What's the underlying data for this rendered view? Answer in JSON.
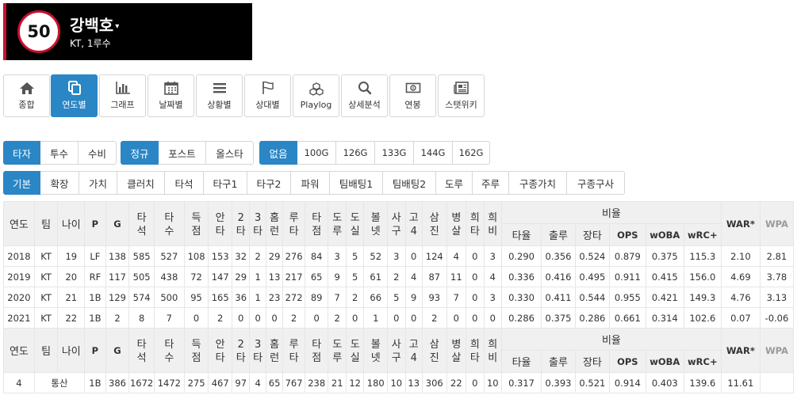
{
  "player": {
    "number": "50",
    "name": "강백호",
    "dropdown_caret": "▾",
    "team_position": "KT, 1루수",
    "accent": "#c8102e"
  },
  "nav": [
    {
      "label": "종합",
      "icon": "home-icon"
    },
    {
      "label": "연도별",
      "icon": "copy-icon",
      "active": true
    },
    {
      "label": "그래프",
      "icon": "bar-chart-icon"
    },
    {
      "label": "날짜별",
      "icon": "calendar-icon"
    },
    {
      "label": "상황별",
      "icon": "list-icon"
    },
    {
      "label": "상대별",
      "icon": "flag-icon"
    },
    {
      "label": "Playlog",
      "icon": "cubes-icon"
    },
    {
      "label": "상세분석",
      "icon": "search-icon"
    },
    {
      "label": "연봉",
      "icon": "money-icon"
    },
    {
      "label": "스탯위키",
      "icon": "newspaper-icon"
    }
  ],
  "filters": {
    "role": [
      "타자",
      "투수",
      "수비"
    ],
    "season_type": [
      "정규",
      "포스트",
      "올스타"
    ],
    "games": [
      "없음",
      "100G",
      "126G",
      "133G",
      "144G",
      "162G"
    ],
    "categories": [
      "기본",
      "확장",
      "가치",
      "클러치",
      "타석",
      "타구1",
      "타구2",
      "파워",
      "팀배팅1",
      "팀배팅2",
      "도루",
      "주루",
      "구종가치",
      "구종구사"
    ]
  },
  "table": {
    "headers": {
      "year": "연도",
      "team": "팀",
      "age": "나이",
      "pos": "P",
      "g": "G",
      "pa": "타석",
      "ab": "타수",
      "r": "득점",
      "h": "안타",
      "b2": "2타",
      "b3": "3타",
      "hr": "홈런",
      "tb": "루타",
      "rbi": "타점",
      "sb": "도루",
      "cs": "도실",
      "bb": "볼넷",
      "hbp": "사구",
      "ibb": "고4",
      "so": "삼진",
      "gdp": "병살",
      "sh": "희타",
      "sf": "희비",
      "ratio": "비율",
      "avg": "타율",
      "obp": "출루",
      "slg": "장타",
      "ops": "OPS",
      "woba": "wOBA",
      "wrc": "wRC+",
      "war": "WAR*",
      "wpa": "WPA"
    },
    "rows": [
      [
        "2018",
        "KT",
        "19",
        "LF",
        "138",
        "585",
        "527",
        "108",
        "153",
        "32",
        "2",
        "29",
        "276",
        "84",
        "3",
        "5",
        "52",
        "3",
        "0",
        "124",
        "4",
        "0",
        "3",
        "0.290",
        "0.356",
        "0.524",
        "0.879",
        "0.375",
        "115.3",
        "2.10",
        "2.81"
      ],
      [
        "2019",
        "KT",
        "20",
        "RF",
        "117",
        "505",
        "438",
        "72",
        "147",
        "29",
        "1",
        "13",
        "217",
        "65",
        "9",
        "5",
        "61",
        "2",
        "4",
        "87",
        "11",
        "0",
        "4",
        "0.336",
        "0.416",
        "0.495",
        "0.911",
        "0.415",
        "156.0",
        "4.69",
        "3.78"
      ],
      [
        "2020",
        "KT",
        "21",
        "1B",
        "129",
        "574",
        "500",
        "95",
        "165",
        "36",
        "1",
        "23",
        "272",
        "89",
        "7",
        "2",
        "66",
        "5",
        "9",
        "93",
        "7",
        "0",
        "3",
        "0.330",
        "0.411",
        "0.544",
        "0.955",
        "0.421",
        "149.3",
        "4.76",
        "3.13"
      ],
      [
        "2021",
        "KT",
        "22",
        "1B",
        "2",
        "8",
        "7",
        "0",
        "2",
        "0",
        "0",
        "0",
        "2",
        "0",
        "2",
        "0",
        "1",
        "0",
        "0",
        "2",
        "0",
        "0",
        "0",
        "0.286",
        "0.375",
        "0.286",
        "0.661",
        "0.314",
        "102.6",
        "0.07",
        "-0.06"
      ]
    ],
    "total_row": [
      "4",
      "통산",
      "1B",
      "386",
      "1672",
      "1472",
      "275",
      "467",
      "97",
      "4",
      "65",
      "767",
      "238",
      "21",
      "12",
      "180",
      "10",
      "13",
      "306",
      "22",
      "0",
      "10",
      "0.317",
      "0.393",
      "0.521",
      "0.914",
      "0.403",
      "139.6",
      "11.61",
      ""
    ]
  }
}
